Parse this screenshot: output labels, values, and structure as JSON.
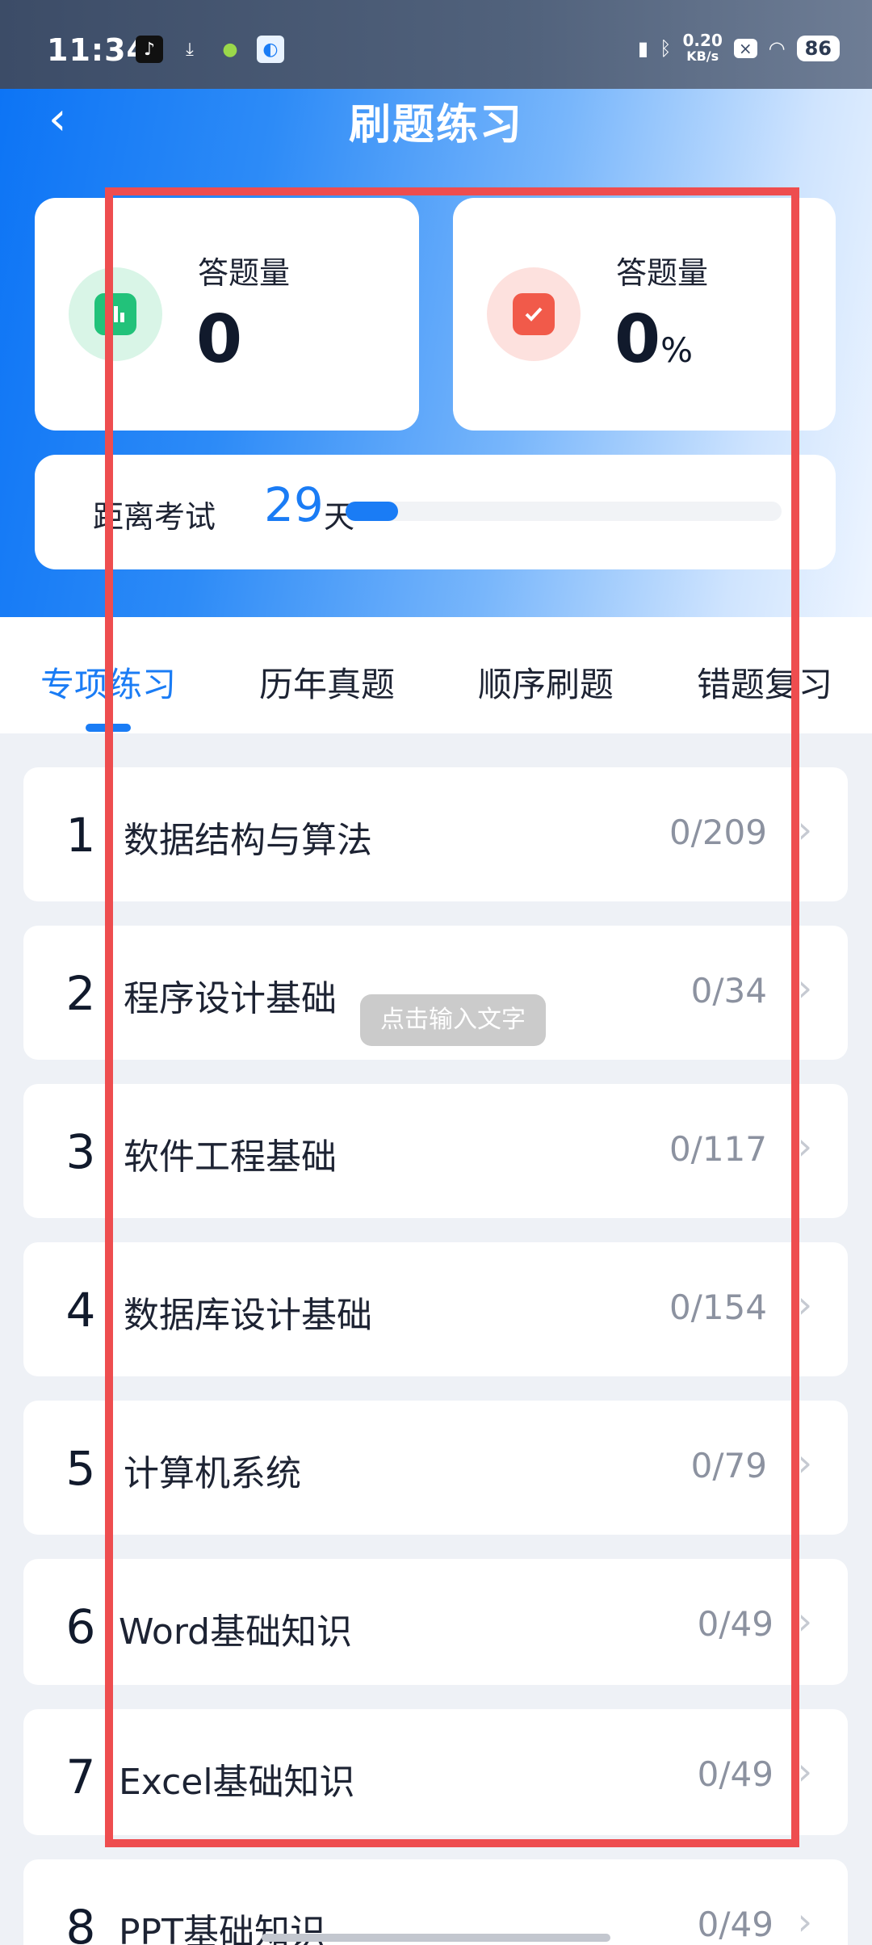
{
  "status_bar": {
    "time": "11:34",
    "net_speed_value": "0.20",
    "net_speed_unit": "KB/s",
    "battery": "86",
    "icons_left": [
      "tiktok-icon",
      "download-icon",
      "vpn-icon",
      "browser-icon"
    ],
    "icons_right": [
      "vibrate-icon",
      "bluetooth-icon",
      "close-box-icon",
      "wifi-icon"
    ]
  },
  "header": {
    "title": "刷题练习",
    "back_icon": "‹"
  },
  "stats": {
    "left": {
      "label": "答题量",
      "value": "0",
      "icon": "chart-icon",
      "color": "#22c27a"
    },
    "right": {
      "label": "答题量",
      "value": "0",
      "unit": "%",
      "icon": "checkbox-icon",
      "color": "#f15a4a"
    }
  },
  "countdown": {
    "label": "距离考试",
    "days": "29",
    "unit": "天",
    "progress": 0.12
  },
  "tabs": [
    {
      "label": "专项练习",
      "active": true
    },
    {
      "label": "历年真题",
      "active": false
    },
    {
      "label": "顺序刷题",
      "active": false
    },
    {
      "label": "错题复习",
      "active": false
    }
  ],
  "items": [
    {
      "num": "1",
      "title": "数据结构与算法",
      "count": "0/209"
    },
    {
      "num": "2",
      "title": "程序设计基础",
      "count": "0/34"
    },
    {
      "num": "3",
      "title": "软件工程基础",
      "count": "0/117"
    },
    {
      "num": "4",
      "title": "数据库设计基础",
      "count": "0/154"
    },
    {
      "num": "5",
      "title": "计算机系统",
      "count": "0/79"
    },
    {
      "num": "6",
      "title": "Word基础知识",
      "count": "0/49"
    },
    {
      "num": "7",
      "title": "Excel基础知识",
      "count": "0/49"
    },
    {
      "num": "8",
      "title": "PPT基础知识",
      "count": "0/49"
    }
  ],
  "tooltip": "点击输入文字",
  "chevron": "›"
}
